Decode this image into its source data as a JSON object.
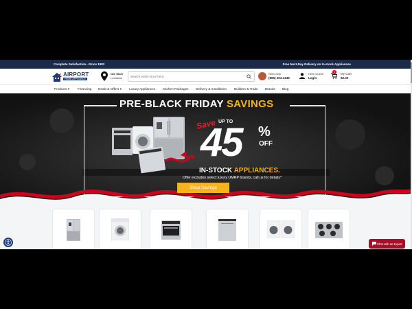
{
  "topbar": {
    "left_text": "Complete Satisfaction...Since 1983",
    "right_text": "Free Next-Day Delivery on In-stock Appliances"
  },
  "header": {
    "logo_brand": "AIRPORT",
    "logo_sub": "HOME APPLIANCE",
    "store_title": "Our Store",
    "store_sub": "Locations",
    "search_placeholder": "Search entire store here...",
    "help_label": "Need help",
    "help_phone": "(866) 204-4449",
    "login_greeting": "Hello Guest!",
    "login_label": "Login",
    "cart_label": "My Cart",
    "cart_total": "$0.00",
    "cart_count": "0"
  },
  "nav": {
    "items": [
      "Products",
      "Financing",
      "Deals & Offers",
      "Luxury Appliances",
      "Kitchen Packages",
      "Delivery & Installation",
      "Builders & Trade",
      "Brands",
      "Blog"
    ]
  },
  "hero": {
    "title_main": "PRE-BLACK FRIDAY ",
    "title_accent": "SAVINGS",
    "save_word": "Save",
    "up_to": "UP TO",
    "percent_number": "45",
    "percent_sign": "%",
    "off_word": "OFF",
    "instock_main": "IN-STOCK ",
    "instock_accent": "APPLIANCES.",
    "exclusion_text": "Offer excludes select luxury UMRP brands, call us for details*",
    "cta_label": "Shop Savings"
  },
  "products": {
    "categories": [
      "refrigerators-icon",
      "washer-icon",
      "range-icon",
      "dishwasher-icon",
      "laundry-pair-icon",
      "cooktop-icon"
    ]
  },
  "chat": {
    "label": "Chat with an Expert"
  },
  "colors": {
    "navy": "#1b2a4a",
    "brand_blue": "#1b3a7a",
    "gold": "#f4b41a",
    "red": "#d0021b",
    "chat_red": "#a8102a"
  }
}
